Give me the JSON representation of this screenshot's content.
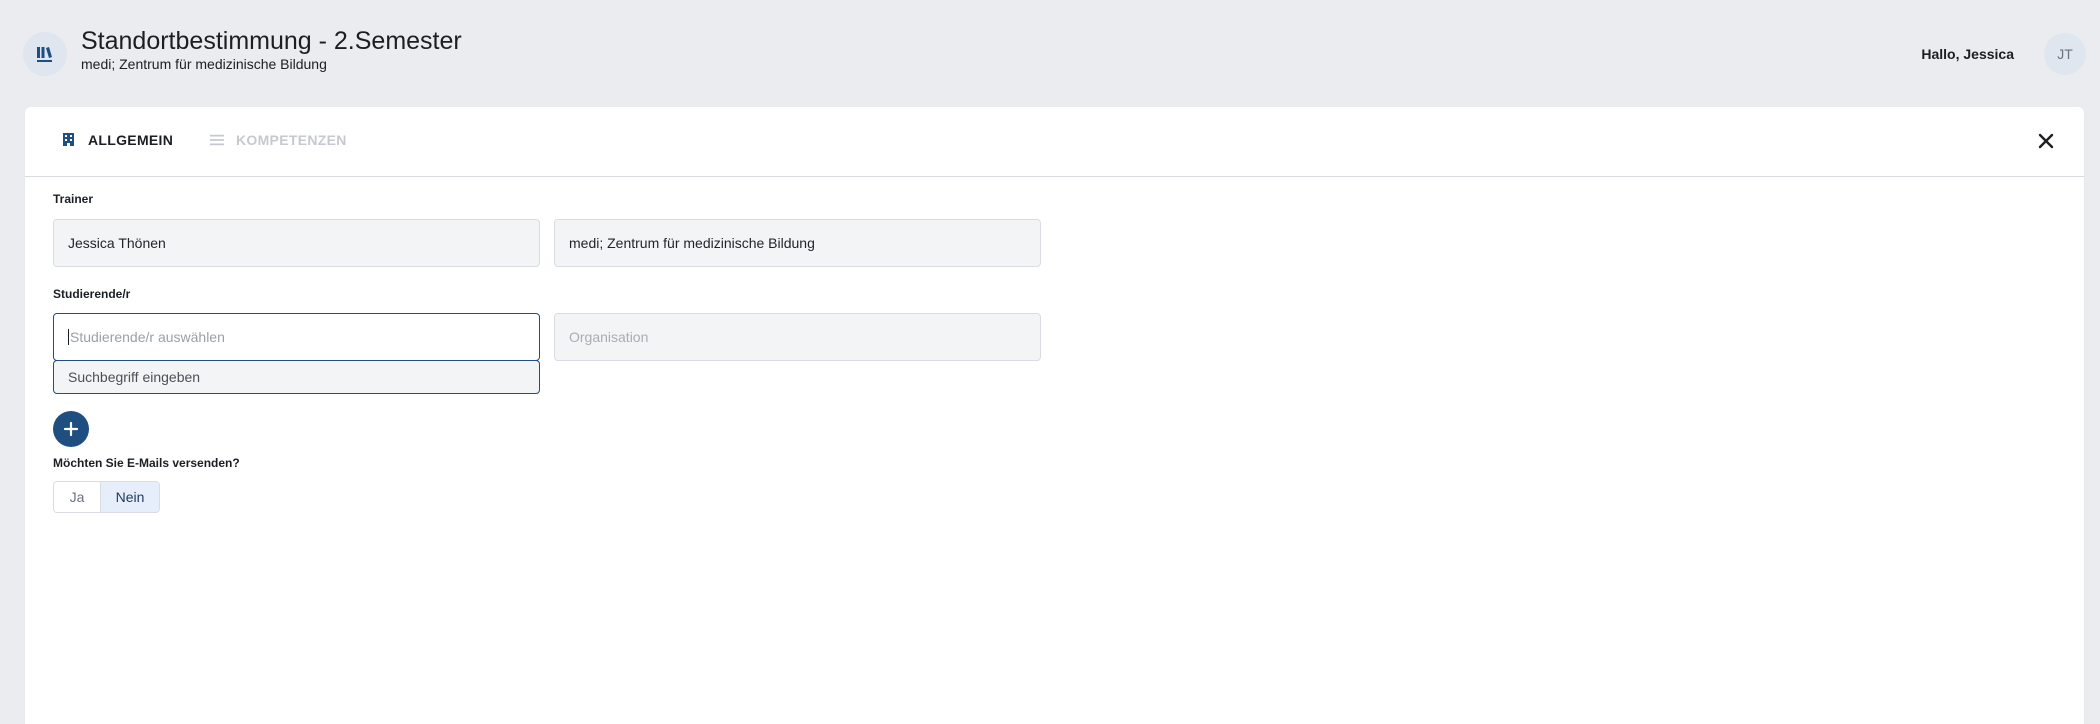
{
  "header": {
    "logo_icon": "library-books-icon",
    "title": "Standortbestimmung - 2.Semester",
    "subtitle": "medi; Zentrum für medizinische Bildung",
    "greeting": "Hallo, Jessica",
    "avatar_initials": "JT"
  },
  "tabs": [
    {
      "label": "ALLGEMEIN",
      "icon": "building-icon",
      "active": true
    },
    {
      "label": "KOMPETENZEN",
      "icon": "list-icon",
      "active": false
    }
  ],
  "close_icon": "close-icon",
  "trainer": {
    "label": "Trainer",
    "name_value": "Jessica Thönen",
    "organisation_value": "medi; Zentrum für medizinische Bildung"
  },
  "student": {
    "label": "Studierende/r",
    "select_placeholder": "Studierende/r auswählen",
    "organisation_placeholder": "Organisation",
    "dropdown_hint": "Suchbegriff eingeben"
  },
  "add_button_icon": "plus-icon",
  "emails": {
    "question": "Möchten Sie E-Mails versenden?",
    "options": [
      "Ja",
      "Nein"
    ],
    "selected": "Nein"
  },
  "colors": {
    "primary": "#1e4f80",
    "background": "#eaecef",
    "selected_toggle": "#e6eefb"
  }
}
